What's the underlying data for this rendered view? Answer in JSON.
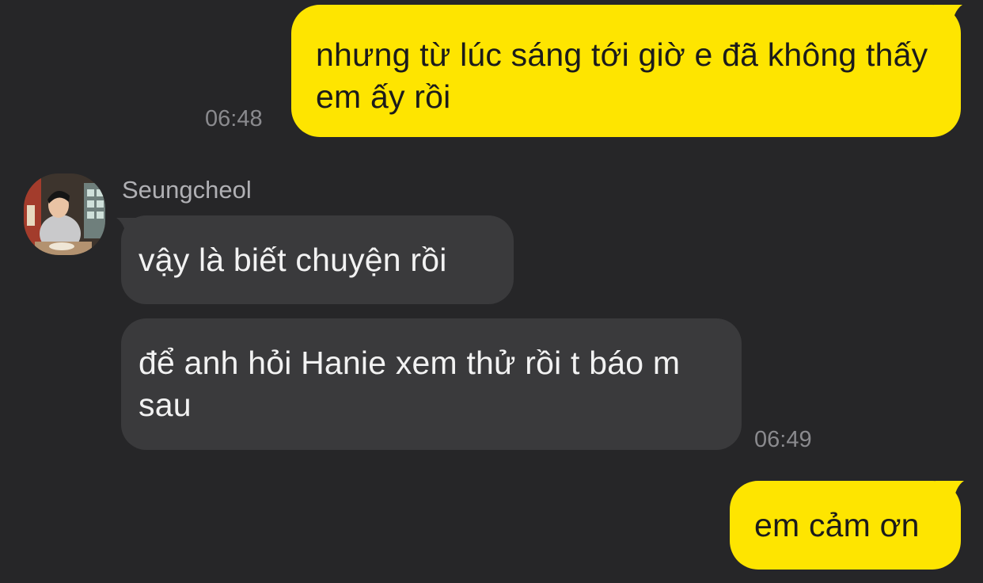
{
  "messages": [
    {
      "id": "m1",
      "direction": "outgoing",
      "text": "nhưng từ lúc sáng tới giờ e đã không thấy em ấy rồi",
      "time": "06:48"
    },
    {
      "id": "m2",
      "direction": "incoming",
      "sender": "Seungcheol",
      "text": "vậy là biết chuyện rồi"
    },
    {
      "id": "m3",
      "direction": "incoming",
      "text": "để anh hỏi Hanie xem thử rồi t báo m sau",
      "time": "06:49"
    },
    {
      "id": "m4",
      "direction": "outgoing",
      "text": "em cảm ơn"
    }
  ],
  "contact": {
    "name": "Seungcheol",
    "avatar": "profile-photo"
  },
  "colors": {
    "background": "#262628",
    "outgoing_bubble": "#fee500",
    "incoming_bubble": "#3a3a3c"
  }
}
